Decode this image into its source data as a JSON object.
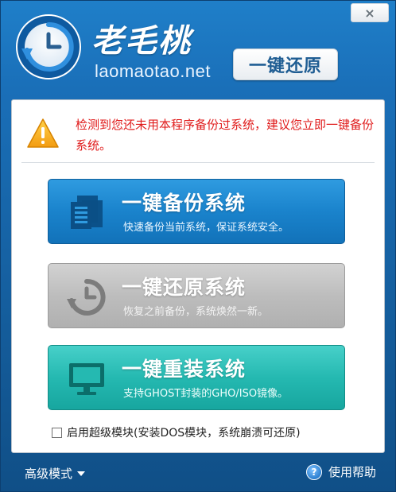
{
  "window": {
    "close_label": "×"
  },
  "brand": {
    "cn": "老毛桃",
    "en": "laomaotao.net",
    "badge": "一键还原"
  },
  "warning": {
    "text": "检测到您还未用本程序备份过系统，建议您立即一键备份系统。"
  },
  "actions": [
    {
      "title": "一键备份系统",
      "desc": "快速备份当前系统，保证系统安全。",
      "icon": "documents-icon"
    },
    {
      "title": "一键还原系统",
      "desc": "恢复之前备份，系统焕然一新。",
      "icon": "restore-clock-icon"
    },
    {
      "title": "一键重装系统",
      "desc": "支持GHOST封装的GHO/ISO镜像。",
      "icon": "monitor-icon"
    }
  ],
  "option": {
    "label": "启用超级模块(安装DOS模块，系统崩溃可还原)",
    "checked": false
  },
  "footer": {
    "advanced_mode": "高级模式",
    "help": "使用帮助"
  },
  "colors": {
    "window_blue": "#1a6fb8",
    "warning_red": "#e01b1b",
    "backup_blue": "#1a83cc",
    "restore_gray": "#bdbdbd",
    "reinstall_teal": "#25b9b1"
  }
}
